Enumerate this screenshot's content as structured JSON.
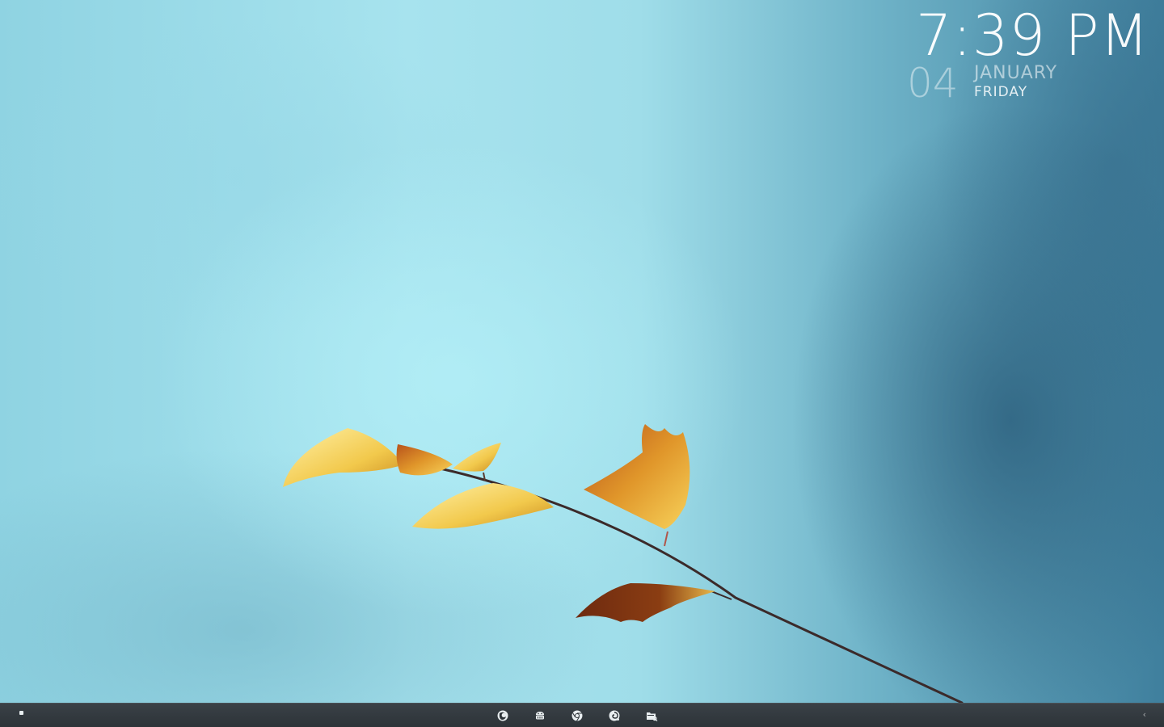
{
  "clock": {
    "time": "7:39 PM",
    "day": "04",
    "month": "JANUARY",
    "weekday": "FRIDAY"
  },
  "taskbar": {
    "start_icon": "start-dot-icon",
    "pinned": [
      {
        "icon": "firefox-icon"
      },
      {
        "icon": "android-store-icon"
      },
      {
        "icon": "chrome-icon"
      },
      {
        "icon": "swirl-app-icon"
      },
      {
        "icon": "file-explorer-icon"
      }
    ],
    "overflow_glyph": "‹"
  },
  "wallpaper": {
    "description_icon": "autumn-leaves-wallpaper",
    "colors": {
      "sky_light": "#a7e3ee",
      "sky_dark": "#3f7f9d",
      "leaf_yellow": "#f2c94c",
      "leaf_brown": "#8a3d12"
    }
  }
}
